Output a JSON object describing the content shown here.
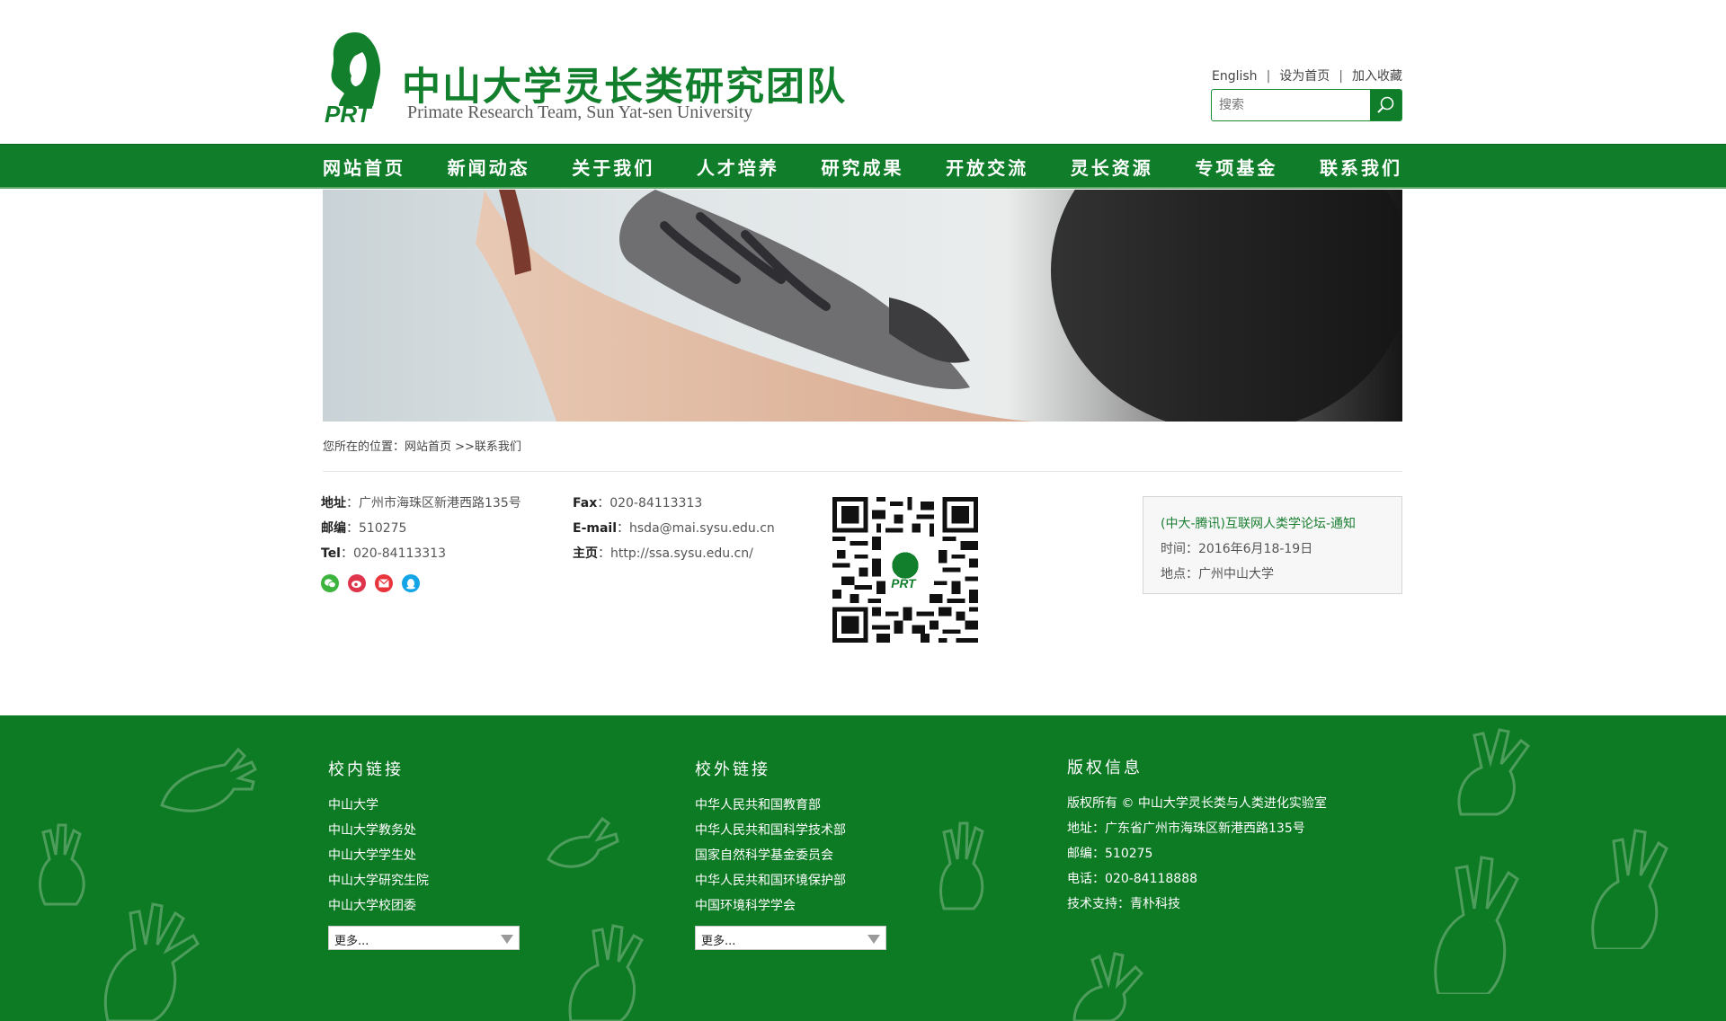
{
  "header": {
    "logo_title": "中山大学灵长类研究团队",
    "logo_subtitle": "Primate Research Team, Sun Yat-sen University",
    "logo_badge": "PRT",
    "toplinks": {
      "english": "English",
      "homepage": "设为首页",
      "favorite": "加入收藏",
      "separator": "|"
    },
    "search_placeholder": "搜索"
  },
  "nav": [
    "网站首页",
    "新闻动态",
    "关于我们",
    "人才培养",
    "研究成果",
    "开放交流",
    "灵长资源",
    "专项基金",
    "联系我们"
  ],
  "breadcrumb": "您所在的位置：网站首页 >>联系我们",
  "contact": {
    "address_label": "地址",
    "address": "：广州市海珠区新港西路135号",
    "postcode_label": "邮编",
    "postcode": "：510275",
    "tel_label": "Tel",
    "tel": "：020-84113313",
    "fax_label": "Fax",
    "fax": "：020-84113313",
    "email_label": "E-mail",
    "email": "：hsda@mai.sysu.edu.cn",
    "home_label": "主页",
    "home": "：http://ssa.sysu.edu.cn/",
    "socials": [
      "wechat-icon",
      "weibo-icon",
      "mail-icon",
      "qq-icon"
    ],
    "qr_badge": "PRT"
  },
  "notice": {
    "title": "(中大-腾讯)互联网人类学论坛-通知",
    "time": "时间：2016年6月18-19日",
    "place": "地点：广州中山大学"
  },
  "footer": {
    "internal": {
      "heading": "校内链接",
      "links": [
        "中山大学",
        "中山大学教务处",
        "中山大学学生处",
        "中山大学研究生院",
        "中山大学校团委"
      ],
      "select": "更多..."
    },
    "external": {
      "heading": "校外链接",
      "links": [
        "中华人民共和国教育部",
        "中华人民共和国科学技术部",
        "国家自然科学基金委员会",
        "中华人民共和国环境保护部",
        "中国环境科学学会"
      ],
      "select": "更多..."
    },
    "copyright": {
      "heading": "版权信息",
      "lines": [
        "版权所有 © 中山大学灵长类与人类进化实验室",
        "地址：广东省广州市海珠区新港西路135号",
        "邮编：510275",
        "电话：020-84118888",
        "技术支持：青朴科技"
      ]
    }
  },
  "colors": {
    "brand_green": "#127f2c",
    "nav_green": "#0f7d29",
    "footer_green": "#0d7a24"
  }
}
